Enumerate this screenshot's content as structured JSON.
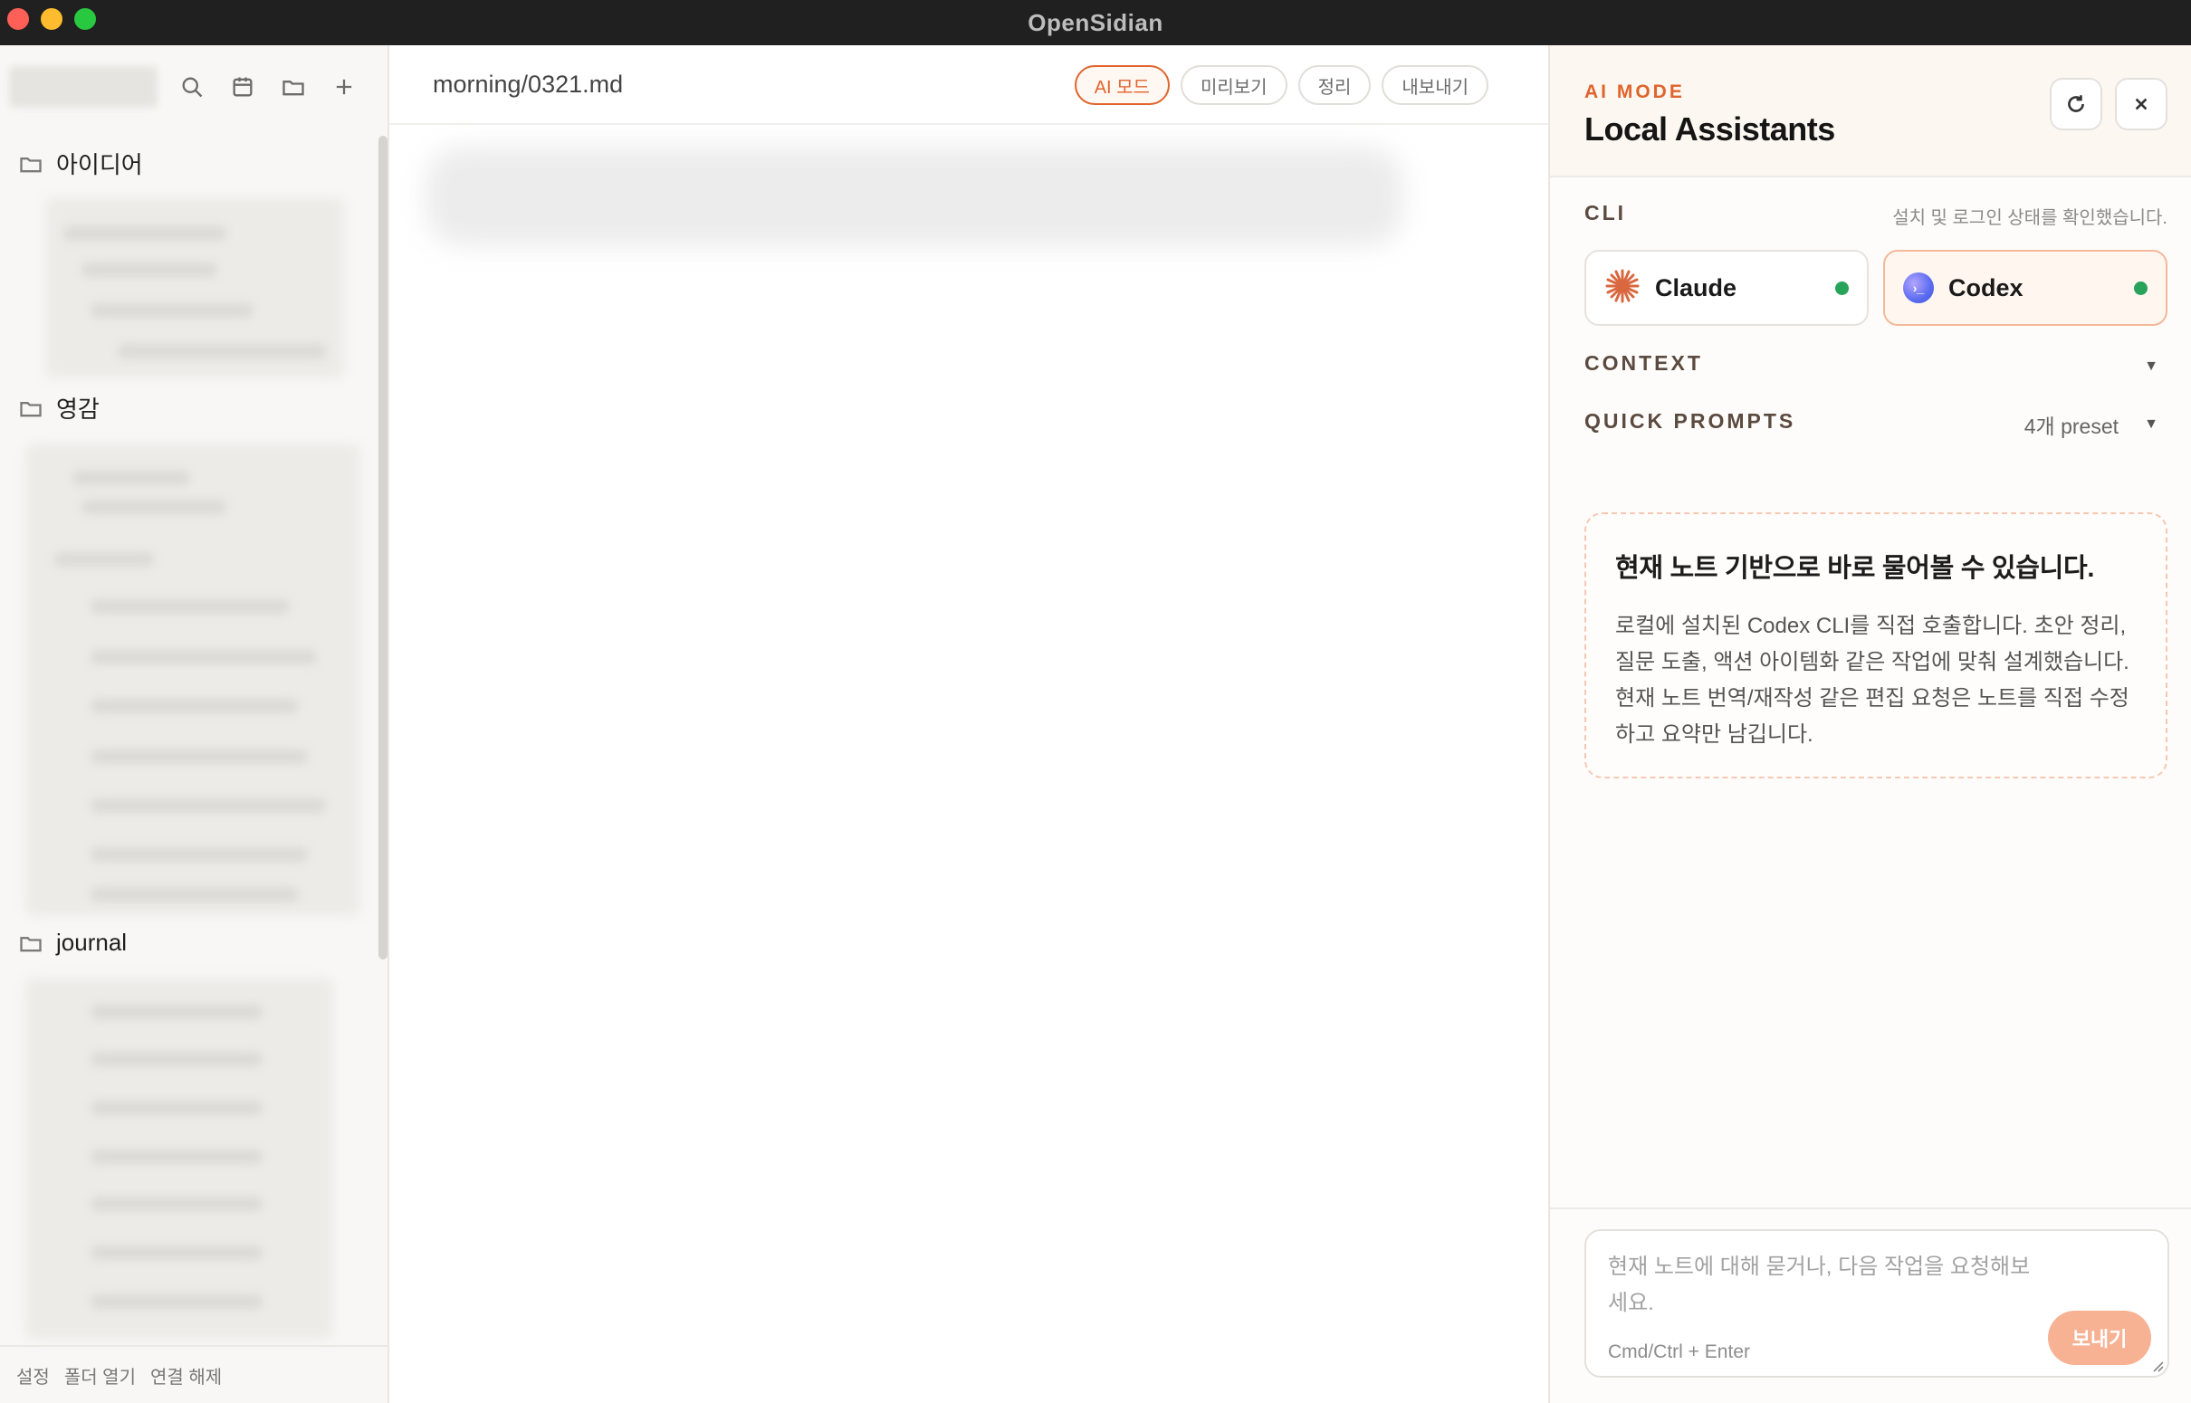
{
  "window": {
    "title": "OpenSidian"
  },
  "sidebar": {
    "folders": [
      {
        "label": "아이디어"
      },
      {
        "label": "영감"
      },
      {
        "label": "journal"
      }
    ],
    "footer": {
      "settings": "설정",
      "open_folder": "폴더 열기",
      "disconnect": "연결 해제"
    }
  },
  "editor": {
    "file_path": "morning/0321.md",
    "tabs": [
      {
        "label": "AI 모드",
        "active": true
      },
      {
        "label": "미리보기",
        "active": false
      },
      {
        "label": "정리",
        "active": false
      },
      {
        "label": "내보내기",
        "active": false
      }
    ]
  },
  "ai_panel": {
    "kicker": "AI MODE",
    "title": "Local Assistants",
    "cli": {
      "label": "CLI",
      "note": "설치 및 로그인 상태를 확인했습니다.",
      "options": [
        {
          "name": "Claude",
          "status": "connected",
          "selected": false
        },
        {
          "name": "Codex",
          "status": "connected",
          "selected": true
        }
      ]
    },
    "context": {
      "label": "CONTEXT"
    },
    "quick_prompts": {
      "label": "QUICK PROMPTS",
      "count": "4개 preset"
    },
    "info": {
      "title": "현재 노트 기반으로 바로 물어볼 수 있습니다.",
      "body": "로컬에 설치된 Codex CLI를 직접 호출합니다. 초안 정리, 질문 도출, 액션 아이템화 같은 작업에 맞춰 설계했습니다. 현재 노트 번역/재작성 같은 편집 요청은 노트를 직접 수정하고 요약만 남깁니다."
    },
    "composer": {
      "placeholder": "현재 노트에 대해 묻거나, 다음 작업을 요청해보세요.",
      "hint": "Cmd/Ctrl + Enter",
      "send_label": "보내기"
    }
  },
  "colors": {
    "accent": "#e0642c",
    "status_ok": "#27a35a",
    "titlebar": "#202020"
  }
}
